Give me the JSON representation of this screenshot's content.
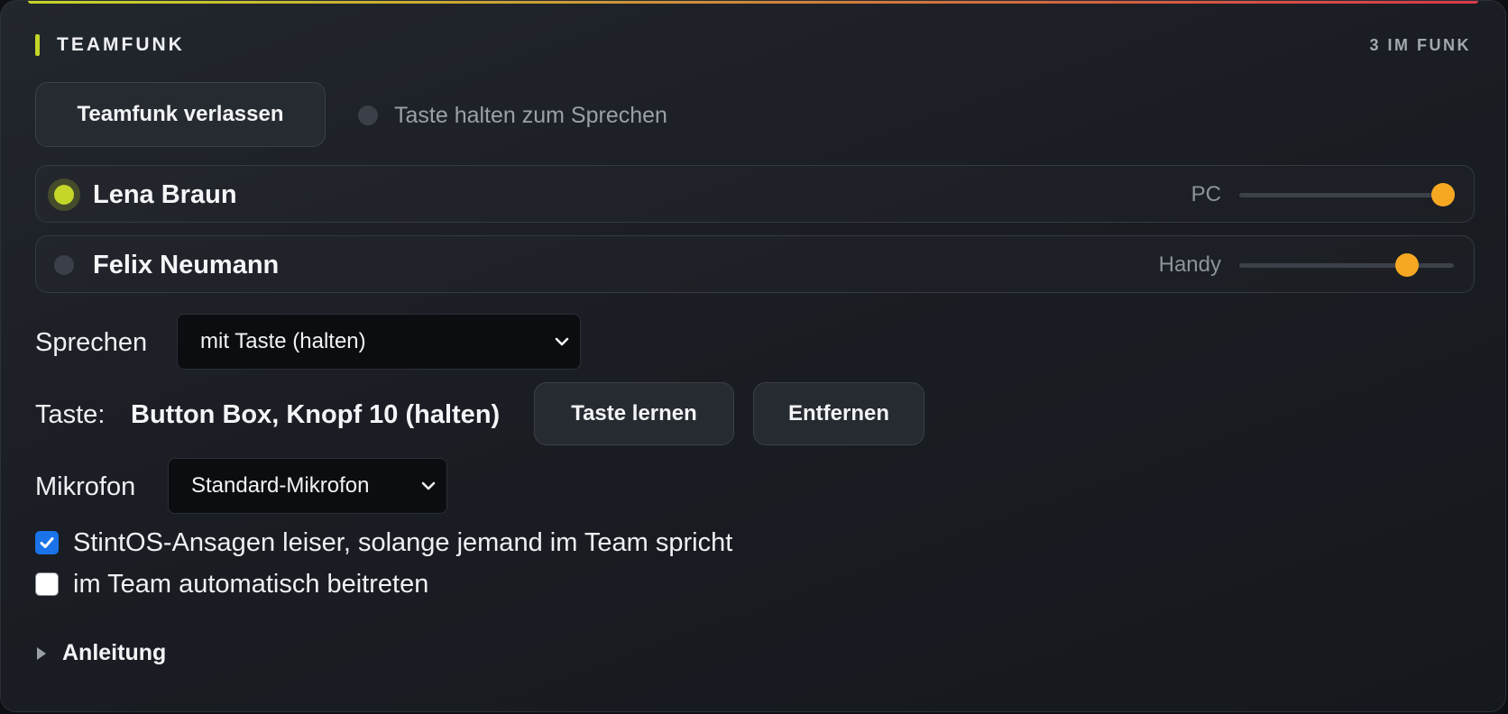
{
  "header": {
    "title": "TEAMFUNK",
    "count": "3 IM FUNK"
  },
  "colors": {
    "accent_lime": "#c4d628",
    "accent_red": "#d9394a",
    "slider_orange": "#f7a823",
    "checkbox_blue": "#1a73e8"
  },
  "controls": {
    "leave_label": "Teamfunk verlassen",
    "ptt_status": "Taste halten zum Sprechen"
  },
  "members": [
    {
      "name": "Lena Braun",
      "device": "PC",
      "active": true,
      "volume": 0.95
    },
    {
      "name": "Felix Neumann",
      "device": "Handy",
      "active": false,
      "volume": 0.78
    }
  ],
  "speak": {
    "label": "Sprechen",
    "selected": "mit Taste (halten)"
  },
  "key": {
    "label": "Taste:",
    "value": "Button Box, Knopf 10 (halten)",
    "learn_label": "Taste lernen",
    "remove_label": "Entfernen"
  },
  "mic": {
    "label": "Mikrofon",
    "selected": "Standard-Mikrofon"
  },
  "options": [
    {
      "label": "StintOS-Ansagen leiser, solange jemand im Team spricht",
      "checked": true
    },
    {
      "label": "im Team automatisch beitreten",
      "checked": false
    }
  ],
  "guide": {
    "label": "Anleitung"
  }
}
